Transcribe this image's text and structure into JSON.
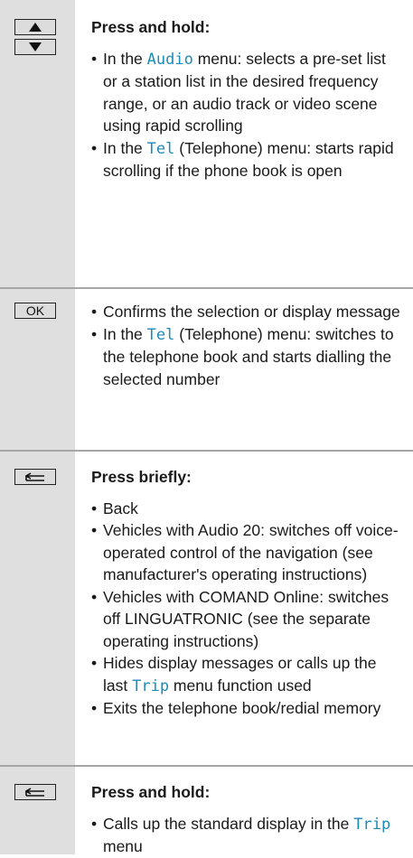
{
  "sections": [
    {
      "keys": [
        "up-arrow",
        "down-arrow"
      ],
      "heading": "Press and hold:",
      "items": [
        {
          "pre": "In the ",
          "term": "Audio",
          "post": " menu: selects a pre-set list or a station list in the desired frequency range, or an audio track or video scene using rapid scrolling"
        },
        {
          "pre": "In the ",
          "term": "Tel",
          "post": " (Telephone) menu: starts rapid scrolling if the phone book is open"
        }
      ]
    },
    {
      "keys": [
        "ok"
      ],
      "ok_label": "OK",
      "heading": "",
      "items": [
        {
          "pre": "Confirms the selection or display message",
          "term": "",
          "post": ""
        },
        {
          "pre": "In the ",
          "term": "Tel",
          "post": " (Telephone) menu: switches to the telephone book and starts dialling the selected number"
        }
      ]
    },
    {
      "keys": [
        "back"
      ],
      "heading": "Press briefly:",
      "items": [
        {
          "pre": "Back",
          "term": "",
          "post": ""
        },
        {
          "pre": "Vehicles with Audio 20: switches off voice-operated control of the navigation (see manufacturer's operating instructions)",
          "term": "",
          "post": ""
        },
        {
          "pre": "Vehicles with COMAND Online: switches off LINGUATRONIC (see the separate operating instructions)",
          "term": "",
          "post": ""
        },
        {
          "pre": "Hides display messages or calls up the last ",
          "term": "Trip",
          "post": " menu function used"
        },
        {
          "pre": "Exits the telephone book/redial memory",
          "term": "",
          "post": ""
        }
      ]
    },
    {
      "keys": [
        "back"
      ],
      "heading": "Press and hold:",
      "items": [
        {
          "pre": "Calls up the standard display in the ",
          "term": "Trip",
          "post": " menu"
        }
      ]
    }
  ],
  "colors": {
    "left_column_bg": "#dfdfdf",
    "divider": "#a6a6a6",
    "term_color": "#1e8ab8"
  }
}
